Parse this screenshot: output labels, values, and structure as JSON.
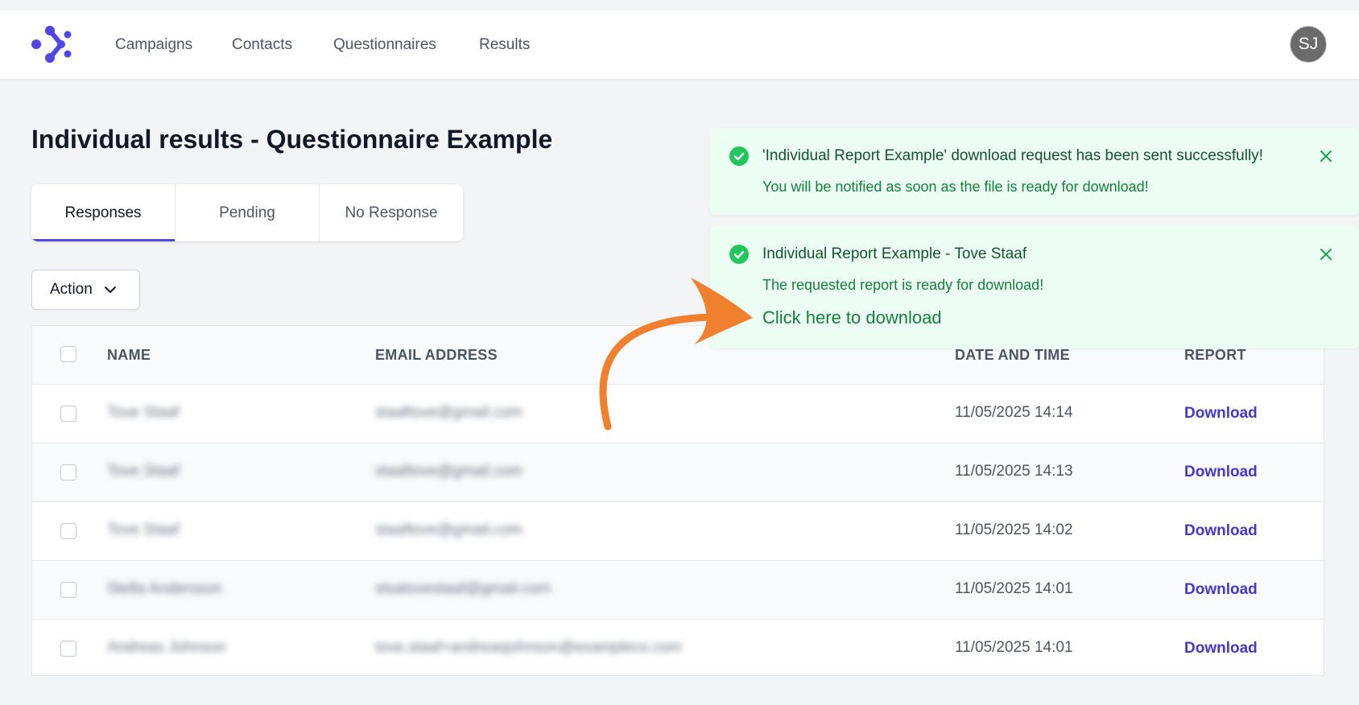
{
  "nav": {
    "links": [
      "Campaigns",
      "Contacts",
      "Questionnaires",
      "Results"
    ],
    "avatar_initials": "SJ"
  },
  "page": {
    "title": "Individual results - Questionnaire Example"
  },
  "tabs": [
    {
      "label": "Responses",
      "active": true
    },
    {
      "label": "Pending",
      "active": false
    },
    {
      "label": "No Response",
      "active": false
    }
  ],
  "action_button": {
    "label": "Action"
  },
  "table": {
    "headers": {
      "name": "NAME",
      "email": "EMAIL ADDRESS",
      "date": "DATE AND TIME",
      "report": "REPORT"
    },
    "rows": [
      {
        "name": "Tove Staaf",
        "email": "staaftove@gmail.com",
        "date": "11/05/2025 14:14",
        "report": "Download"
      },
      {
        "name": "Tove Staaf",
        "email": "staaftove@gmail.com",
        "date": "11/05/2025 14:13",
        "report": "Download"
      },
      {
        "name": "Tove Staaf",
        "email": "staaftove@gmail.com",
        "date": "11/05/2025 14:02",
        "report": "Download"
      },
      {
        "name": "Stella Andersson",
        "email": "stsatovestaaf@gmail.com",
        "date": "11/05/2025 14:01",
        "report": "Download"
      },
      {
        "name": "Andreas Johnson",
        "email": "tove.staaf+andreasjohnson@exampleco.com",
        "date": "11/05/2025 14:01",
        "report": "Download"
      }
    ]
  },
  "toasts": [
    {
      "title": "'Individual Report Example' download request has been sent successfully!",
      "message": "You will be notified as soon as the file is ready for download!"
    },
    {
      "title": "Individual Report Example - Tove Staaf",
      "message": "The requested report is ready for download!",
      "link": "Click here to download"
    }
  ],
  "colors": {
    "accent": "#4f46e5",
    "link": "#4338ca",
    "success_bg": "#ecfdf3",
    "success_icon": "#22c55e",
    "annotation_arrow": "#f07f2e"
  }
}
